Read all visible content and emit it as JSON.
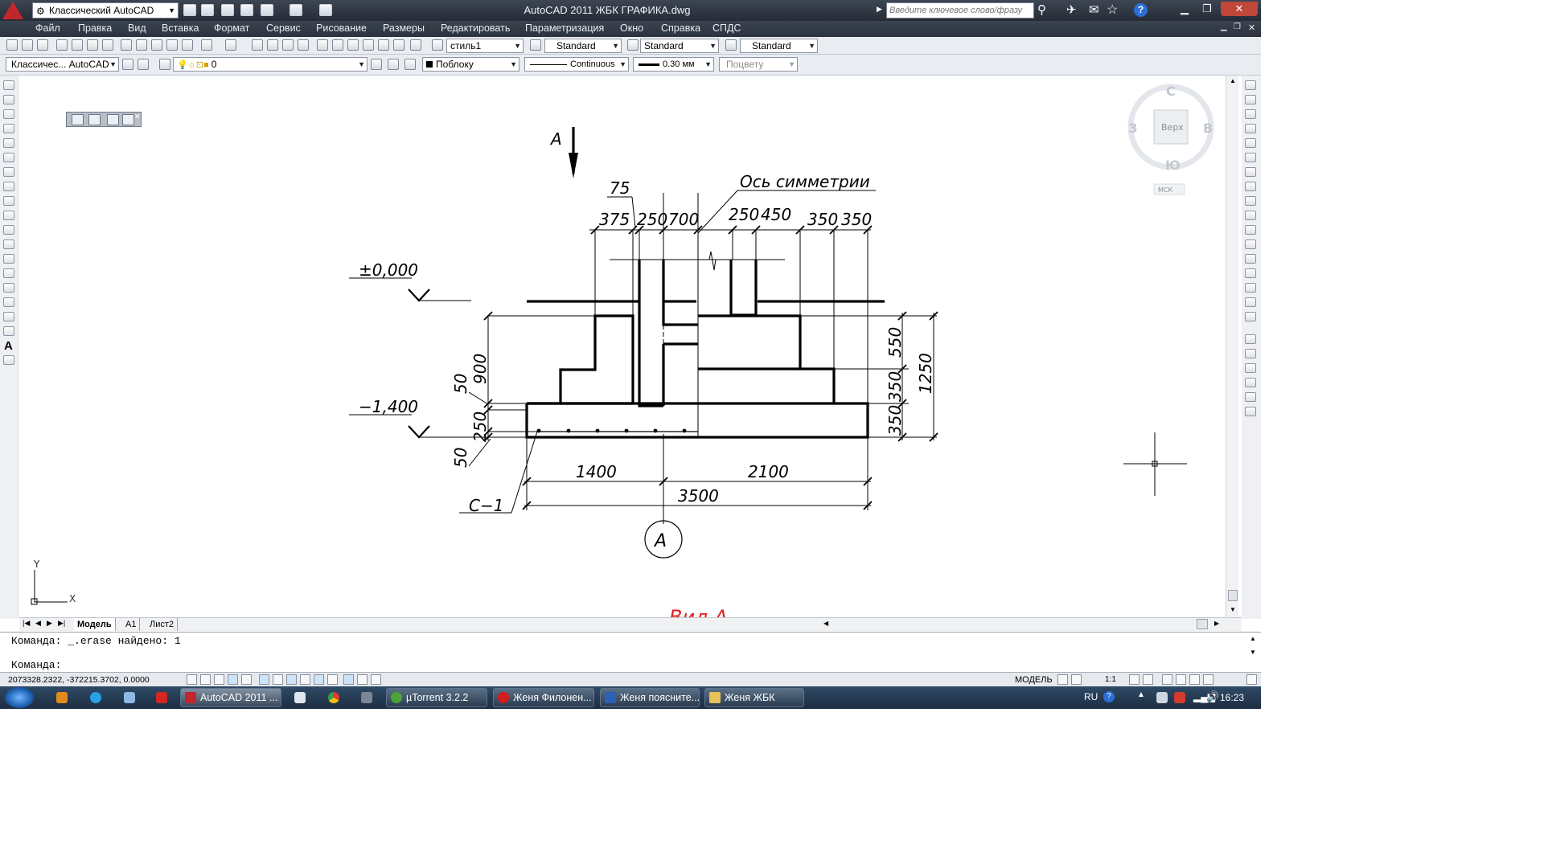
{
  "title_bar": {
    "workspace": "Классический AutoCAD",
    "app_title": "AutoCAD 2011    ЖБК ГРАФИКА.dwg",
    "search_placeholder": "Введите ключевое слово/фразу"
  },
  "menu": [
    "Файл",
    "Правка",
    "Вид",
    "Вставка",
    "Формат",
    "Сервис",
    "Рисование",
    "Размеры",
    "Редактировать",
    "Параметризация",
    "Окно",
    "Справка",
    "СПДС"
  ],
  "toolbar": {
    "text_style": "стиль1",
    "dim_style": "Standard",
    "table_style": "Standard",
    "mleader_style": "Standard",
    "workspace_short": "Классичес... AutoCAD",
    "layer": "0",
    "color": "Поблоку",
    "linetype": "Continuous",
    "lineweight": "0.30 мм",
    "plotstyle": "Поцвету"
  },
  "viewcube": {
    "north": "С",
    "south": "Ю",
    "west": "З",
    "east": "В",
    "face": "Верх",
    "ucs": "МСК"
  },
  "drawing": {
    "section_mark": "А",
    "axis_label": "Ось симметрии",
    "top_dim_75": "75",
    "top_dims": [
      "375",
      "250",
      "700",
      "250",
      "450",
      "350",
      "350"
    ],
    "level_top": "±0,000",
    "level_bottom": "−1,400",
    "left_dims": [
      "50",
      "900",
      "250",
      "50"
    ],
    "right_dims": [
      "550",
      "350",
      "350",
      "1250"
    ],
    "bottom_dims": [
      "1400",
      "2100",
      "3500"
    ],
    "mesh_label": "С−1",
    "axis_bubble": "А",
    "view_caption": "Вид А"
  },
  "ucs_icon": {
    "y": "Y",
    "x": "X"
  },
  "tabs": [
    "Модель",
    "А1",
    "Лист2"
  ],
  "command": {
    "history": "Команда:  _.erase найдено: 1",
    "prompt": "Команда:"
  },
  "status": {
    "coords": "2073328.2322, -372215.3702, 0.0000",
    "model_label": "МОДЕЛЬ",
    "scale": "1:1"
  },
  "taskbar": {
    "items": [
      "AutoCAD 2011 ...",
      "µTorrent 3.2.2",
      "Женя Филонен...",
      "Женя поясните...",
      "Женя ЖБК"
    ],
    "lang": "RU",
    "time": "16:23"
  },
  "colors": {
    "title_bg": "#2c333e",
    "caption_red": "#e02020",
    "taskbar_bg": "#1f3148"
  }
}
